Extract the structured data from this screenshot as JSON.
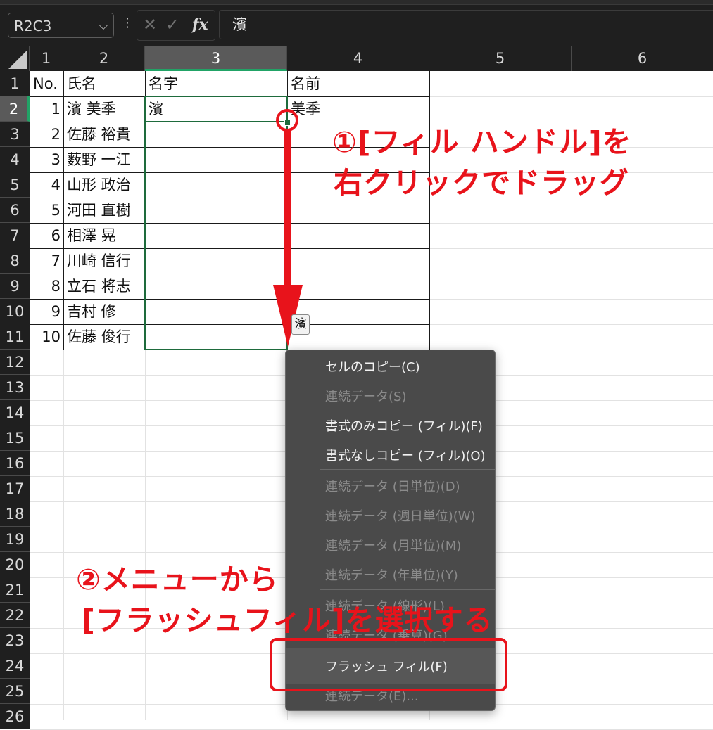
{
  "formula_bar": {
    "name_box": "R2C3",
    "name_box_chevron": "⌵",
    "more_icon": "⋮",
    "cancel_icon": "✕",
    "enter_icon": "✓",
    "fx_label": "fx",
    "formula": "濱"
  },
  "columns": [
    "1",
    "2",
    "3",
    "4",
    "5",
    "6"
  ],
  "rows": [
    "1",
    "2",
    "3",
    "4",
    "5",
    "6",
    "7",
    "8",
    "9",
    "10",
    "11",
    "12",
    "13",
    "14",
    "15",
    "16",
    "17",
    "18",
    "19",
    "20",
    "21",
    "22",
    "23",
    "24",
    "25",
    "26"
  ],
  "table": {
    "headers": [
      "No.",
      "氏名",
      "名字",
      "名前"
    ],
    "numbers": [
      "1",
      "2",
      "3",
      "4",
      "5",
      "6",
      "7",
      "8",
      "9",
      "10"
    ],
    "names": [
      "濱 美季",
      "佐藤 裕貴",
      "薮野 一江",
      "山形 政治",
      "河田 直樹",
      "相澤 晃",
      "川崎 信行",
      "立石 将志",
      "吉村 修",
      "佐藤 俊行"
    ],
    "surname_r2": "濱",
    "given_r2": "美季"
  },
  "fill_tooltip": "濱",
  "context_menu": {
    "items": [
      {
        "label": "セルのコピー(C)",
        "enabled": true
      },
      {
        "label": "連続データ(S)",
        "enabled": false
      },
      {
        "label": "書式のみコピー (フィル)(F)",
        "enabled": true
      },
      {
        "label": "書式なしコピー (フィル)(O)",
        "enabled": true
      },
      {
        "label": "連続データ (日単位)(D)",
        "enabled": false
      },
      {
        "label": "連続データ (週日単位)(W)",
        "enabled": false
      },
      {
        "label": "連続データ (月単位)(M)",
        "enabled": false
      },
      {
        "label": "連続データ (年単位)(Y)",
        "enabled": false
      },
      {
        "label": "連続データ (線形)(L)",
        "enabled": false
      },
      {
        "label": "連続データ (乗算)(G)",
        "enabled": false
      },
      {
        "label": "フラッシュ フィル(F)",
        "enabled": true
      },
      {
        "label": "連続データ(E)...",
        "enabled": false
      }
    ]
  },
  "annotations": {
    "step1_line1": "①[フィル ハンドル]を",
    "step1_line2": "右クリックでドラッグ",
    "step2_line1": "②メニューから",
    "step2_line2": "[フラッシュフィル]を選択する"
  },
  "colors": {
    "annotation_red": "#e8131b",
    "selection_green": "#1e6b3c",
    "header_dark": "#1f1f1f",
    "menu_bg": "#4a4a4a"
  }
}
